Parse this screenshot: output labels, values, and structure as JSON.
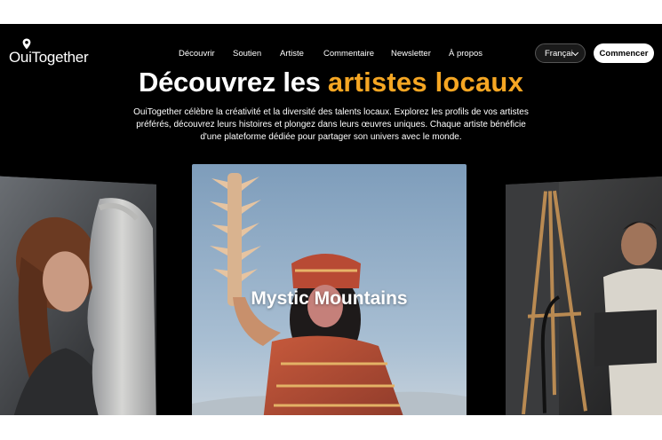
{
  "brand": {
    "name": "OuiTogether",
    "logo_icon": "location-pin-icon"
  },
  "nav": {
    "links": [
      "Découvrir",
      "Soutien",
      "Artiste",
      "Commentaire",
      "Newsletter",
      "À propos"
    ],
    "language": "Françai",
    "cta": "Commencer"
  },
  "hero": {
    "title_part1": "Découvrez les",
    "title_accent": "artistes locaux",
    "accent_color": "#f5a623",
    "subtitle_line1": "OuiTogether célèbre la créativité et la diversité des talents locaux. Explorez les profils de vos artistes",
    "subtitle_line2": "préférés, découvrez leurs histoires et plongez dans leurs œuvres uniques. Chaque artiste bénéficie",
    "subtitle_line3": "d'une plateforme dédiée pour partager son univers avec le monde."
  },
  "carousel": {
    "cards": [
      {
        "title": ""
      },
      {
        "title": "Mystic Mountains"
      },
      {
        "title": ""
      }
    ]
  }
}
